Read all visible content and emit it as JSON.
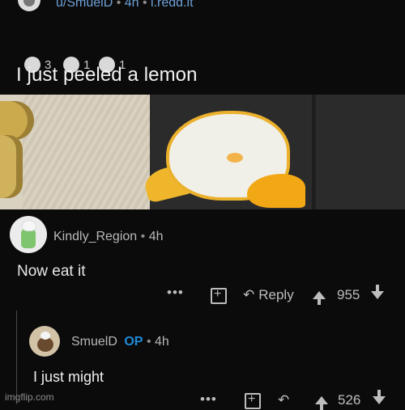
{
  "post": {
    "author": "u/SmuelD",
    "age": "4h",
    "domain": "i.redd.it",
    "title": "I just peeled a lemon",
    "awards": [
      {
        "count": "3"
      },
      {
        "count": "1"
      },
      {
        "count": "1"
      }
    ]
  },
  "comment": {
    "author": "Kindly_Region",
    "age": "4h",
    "body": "Now eat it",
    "actions": {
      "more": "•••",
      "reply": "Reply",
      "score": "955"
    }
  },
  "reply": {
    "author": "SmuelD",
    "badge": "OP",
    "age": "4h",
    "body": "I just might",
    "actions": {
      "more": "•••",
      "score": "526"
    }
  },
  "watermark": "imgflip.com"
}
